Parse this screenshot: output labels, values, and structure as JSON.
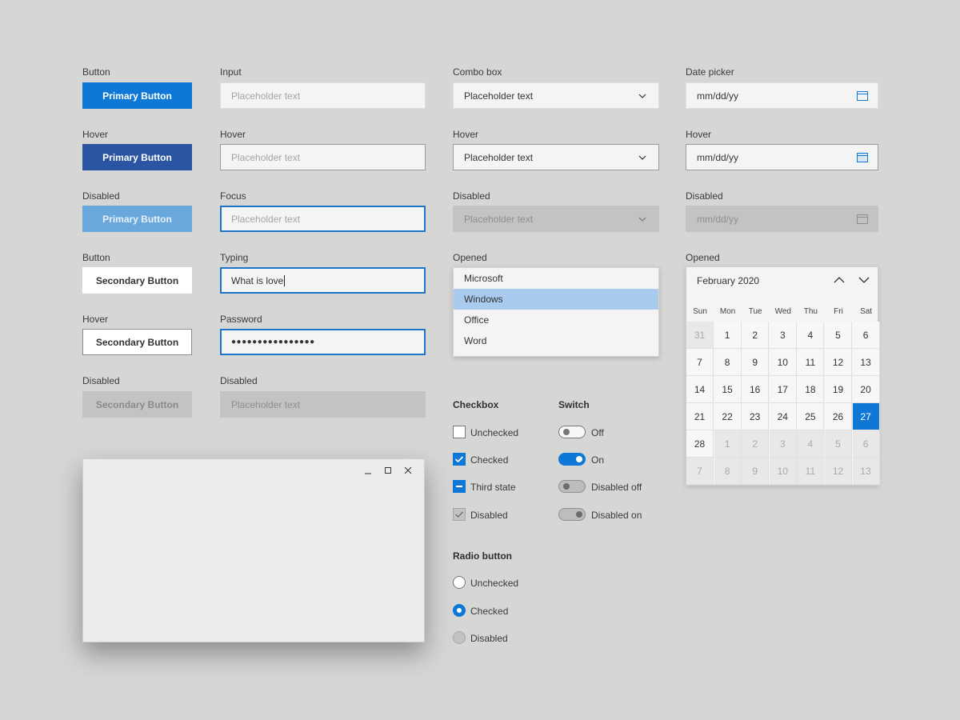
{
  "buttons": {
    "label_button": "Button",
    "label_hover": "Hover",
    "label_disabled": "Disabled",
    "primary_label": "Primary Button",
    "secondary_label": "Secondary Button"
  },
  "input": {
    "label_input": "Input",
    "label_hover": "Hover",
    "label_focus": "Focus",
    "label_typing": "Typing",
    "label_password": "Password",
    "label_disabled": "Disabled",
    "placeholder": "Placeholder text",
    "typing_value": "What is love",
    "password_value": "●●●●●●●●●●●●●●●●"
  },
  "combo": {
    "label_combo": "Combo box",
    "label_hover": "Hover",
    "label_disabled": "Disabled",
    "label_opened": "Opened",
    "placeholder": "Placeholder text",
    "options": [
      "Microsoft",
      "Windows",
      "Office",
      "Word"
    ],
    "selected_option": "Windows"
  },
  "datepicker": {
    "label_date": "Date picker",
    "label_hover": "Hover",
    "label_disabled": "Disabled",
    "label_opened": "Opened",
    "placeholder": "mm/dd/yy",
    "month": "February 2020",
    "weekdays": [
      "Sun",
      "Mon",
      "Tue",
      "Wed",
      "Thu",
      "Fri",
      "Sat"
    ],
    "weeks": [
      [
        "31",
        "1",
        "2",
        "3",
        "4",
        "5",
        "6"
      ],
      [
        "7",
        "8",
        "9",
        "10",
        "11",
        "12",
        "13"
      ],
      [
        "14",
        "15",
        "16",
        "17",
        "18",
        "19",
        "20"
      ],
      [
        "21",
        "22",
        "23",
        "24",
        "25",
        "26",
        "27"
      ],
      [
        "28",
        "1",
        "2",
        "3",
        "4",
        "5",
        "6"
      ],
      [
        "7",
        "8",
        "9",
        "10",
        "11",
        "12",
        "13"
      ]
    ],
    "selected_day": "27"
  },
  "checkbox": {
    "title": "Checkbox",
    "unchecked": "Unchecked",
    "checked": "Checked",
    "third": "Third state",
    "disabled": "Disabled"
  },
  "switch": {
    "title": "Switch",
    "off": "Off",
    "on": "On",
    "disabled_off": "Disabled off",
    "disabled_on": "Disabled on"
  },
  "radio": {
    "title": "Radio button",
    "unchecked": "Unchecked",
    "checked": "Checked",
    "disabled": "Disabled"
  },
  "colors": {
    "accent": "#0f78d7",
    "accent_hover": "#2b55a3",
    "accent_disabled": "#6aa8dc",
    "background": "#d6d6d4",
    "dropdown_selected": "#a8cbee"
  },
  "icons": {
    "chevron": "chevron-down-icon",
    "calendar": "calendar-icon",
    "window_buttons": [
      "minimize-icon",
      "maximize-icon",
      "close-icon"
    ]
  }
}
